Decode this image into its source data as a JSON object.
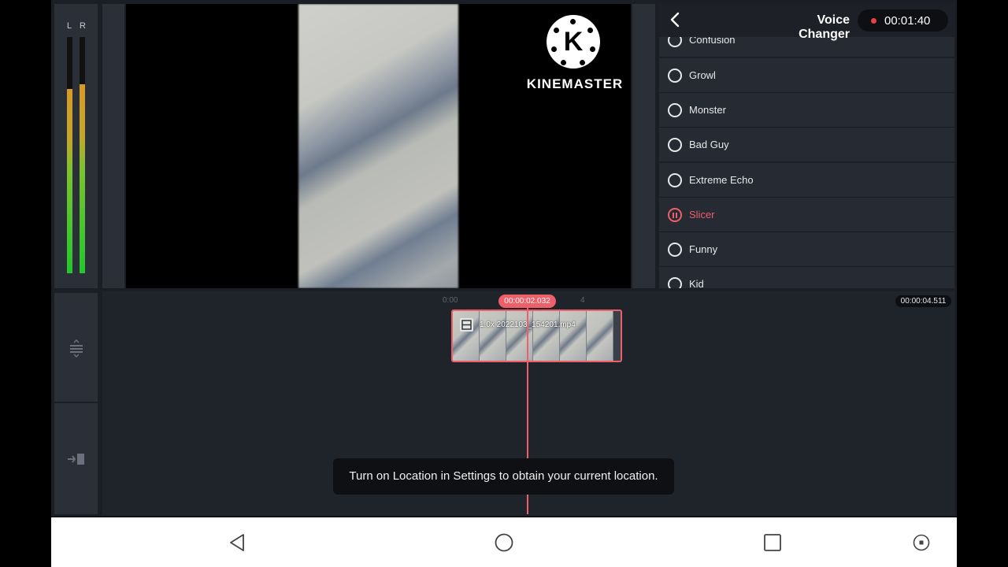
{
  "meter": {
    "left_label": "L",
    "right_label": "R",
    "left_level": 0.78,
    "right_level": 0.8
  },
  "preview": {
    "logo_letter": "K",
    "logo_text": "KINEMASTER"
  },
  "panel": {
    "title": "Voice Changer",
    "recording_time": "00:01:40",
    "items": [
      {
        "label": "Confusion",
        "active": false
      },
      {
        "label": "Growl",
        "active": false
      },
      {
        "label": "Monster",
        "active": false
      },
      {
        "label": "Bad Guy",
        "active": false
      },
      {
        "label": "Extreme Echo",
        "active": false
      },
      {
        "label": "Slicer",
        "active": true
      },
      {
        "label": "Funny",
        "active": false
      },
      {
        "label": "Kid",
        "active": false
      }
    ]
  },
  "timeline": {
    "ruler_start": "0:00",
    "ruler_mark": "4",
    "playhead_time": "00:00:02.032",
    "end_time": "00:00:04.511",
    "clip_name": "1.0x 2022103_154201.mp4"
  },
  "toast": {
    "message": "Turn on Location in Settings to obtain your current location."
  },
  "colors": {
    "accent": "#ef5f6a",
    "panel_bg": "#262a32",
    "app_bg": "#1b1e24"
  }
}
